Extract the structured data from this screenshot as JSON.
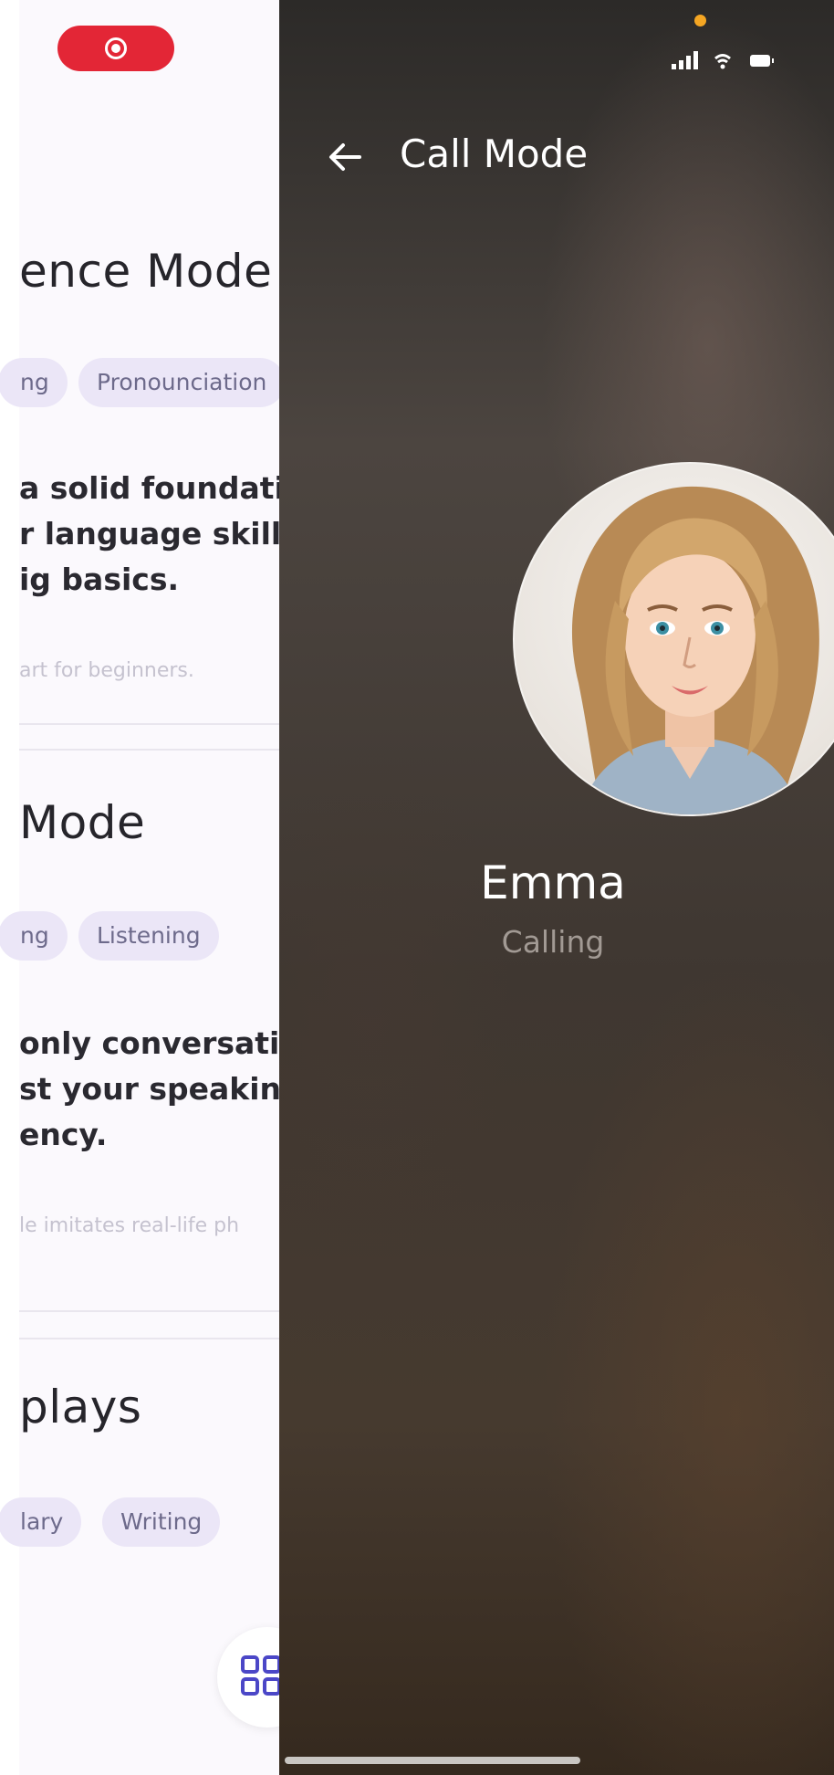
{
  "left_screen": {
    "modes": [
      {
        "title": "ence Mode",
        "tags": [
          "ng",
          "Pronounciation"
        ],
        "description_lines": [
          "a solid foundation",
          "r language skills",
          "ig basics."
        ],
        "note": "art for beginners."
      },
      {
        "title": "Mode",
        "tags": [
          "ng",
          "Listening"
        ],
        "description_lines": [
          "only conversatio",
          "st your speaking",
          "ency."
        ],
        "note": "le imitates real-life ph"
      },
      {
        "title": "plays",
        "tags": [
          "lary",
          "Writing"
        ]
      }
    ],
    "fab_icon": "grid-icon"
  },
  "call_screen": {
    "title": "Call Mode",
    "back_icon": "arrow-left-icon",
    "caller_name": "Emma",
    "call_status": "Calling",
    "avatar_icon": "caller-portrait",
    "indicator_color": "#f5a623"
  },
  "colors": {
    "record_pill": "#e32636",
    "tag_bg": "#ebe6f7",
    "tag_text": "#6d6a8b",
    "accent": "#4b47c7"
  }
}
